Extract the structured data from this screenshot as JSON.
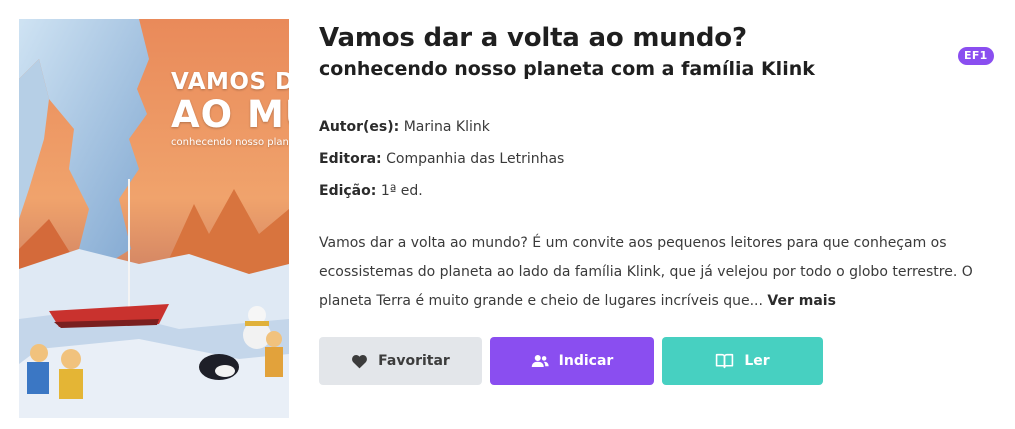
{
  "cover": {
    "line1": "VAMOS DAR",
    "line2": "AO MU",
    "line3": "conhecendo nosso plane"
  },
  "book": {
    "title": "Vamos dar a volta ao mundo?",
    "subtitle": "conhecendo nosso planeta com a família Klink",
    "badge": "EF1"
  },
  "meta": {
    "author_label": "Autor(es):",
    "author": "Marina Klink",
    "publisher_label": "Editora:",
    "publisher": "Companhia das Letrinhas",
    "edition_label": "Edição:",
    "edition": "1ª ed."
  },
  "description": {
    "text": "Vamos dar a volta ao mundo? É um convite aos pequenos leitores para que conheçam os ecossistemas do planeta ao lado da família Klink, que já velejou por todo o globo terrestre. O planeta Terra é muito grande e cheio de lugares incríveis que... ",
    "more_label": "Ver mais"
  },
  "actions": {
    "favorite_label": "Favoritar",
    "recommend_label": "Indicar",
    "read_label": "Ler"
  },
  "colors": {
    "purple": "#8a4ef0",
    "teal": "#47d0c1",
    "gray": "#e3e6ea"
  },
  "icons": {
    "favorite": "heart-icon",
    "recommend": "users-icon",
    "read": "open-book-icon"
  }
}
